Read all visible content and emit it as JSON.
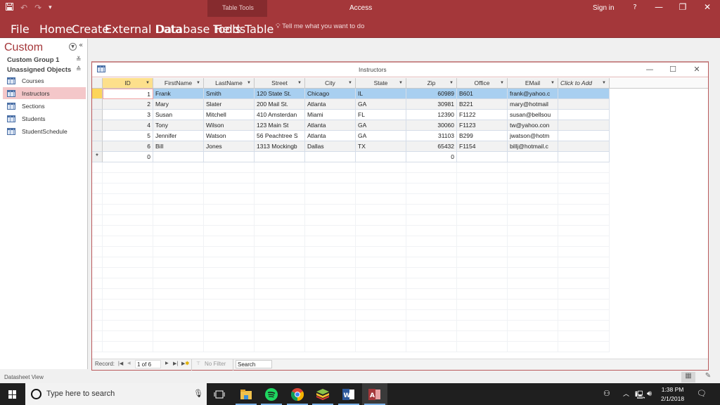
{
  "window": {
    "app_title": "Access",
    "contextual_title": "Table Tools",
    "sign_in": "Sign in",
    "help": "?",
    "minimize": "—",
    "restore": "❐",
    "close": "✕"
  },
  "qat": {
    "save": "💾",
    "undo": "↶",
    "redo": "↷",
    "customize": "⩡"
  },
  "ribbon": {
    "tabs": [
      {
        "label": "File"
      },
      {
        "label": "Home"
      },
      {
        "label": "Create"
      },
      {
        "label": "External Data"
      },
      {
        "label": "Database Tools"
      },
      {
        "label": "Fields"
      },
      {
        "label": "Table"
      }
    ],
    "tell_me": "Tell me what you want to do"
  },
  "nav": {
    "title": "Custom",
    "groups": [
      {
        "label": "Custom Group 1",
        "chevron": "⌄"
      },
      {
        "label": "Unassigned Objects",
        "chevron": "⌃"
      }
    ],
    "items": [
      {
        "label": "Courses"
      },
      {
        "label": "Instructors",
        "selected": true
      },
      {
        "label": "Sections"
      },
      {
        "label": "Students"
      },
      {
        "label": "StudentSchedule"
      }
    ]
  },
  "doc": {
    "title": "Instructors",
    "columns": [
      "ID",
      "FirstName",
      "LastName",
      "Street",
      "City",
      "State",
      "Zip",
      "Office",
      "EMail",
      "Click to Add"
    ],
    "rows": [
      [
        "1",
        "Frank",
        "Smith",
        "120 State St.",
        "Chicago",
        "IL",
        "60989",
        "B601",
        "frank@yahoo.c"
      ],
      [
        "2",
        "Mary",
        "Slater",
        "200 Mail St.",
        "Atlanta",
        "GA",
        "30981",
        "B221",
        "mary@hotmail"
      ],
      [
        "3",
        "Susan",
        "Mitchell",
        "410 Amsterdan",
        "Miami",
        "FL",
        "12390",
        "F1122",
        "susan@bellsou"
      ],
      [
        "4",
        "Tony",
        "Wilson",
        "123 Main St",
        "Atlanta",
        "GA",
        "30060",
        "F1123",
        "tw@yahoo.con"
      ],
      [
        "5",
        "Jennifer",
        "Watson",
        "56 Peachtree S",
        "Atlanta",
        "GA",
        "31103",
        "B299",
        "jwatson@hotm"
      ],
      [
        "6",
        "Bill",
        "Jones",
        "1313 Mockingb",
        "Dallas",
        "TX",
        "65432",
        "F1154",
        "billj@hotmail.c"
      ]
    ],
    "new_row": {
      "marker": "*",
      "id": "0",
      "zip": "0"
    }
  },
  "recnav": {
    "label": "Record:",
    "first": "⏮",
    "prev": "◀",
    "current": "1 of 6",
    "next": "▶",
    "last": "⏭",
    "new": "▶✱",
    "filter": "No Filter",
    "search": "Search"
  },
  "status": {
    "view": "Datasheet View"
  },
  "taskbar": {
    "search_placeholder": "Type here to search",
    "time": "1:38 PM",
    "date": "2/1/2018"
  }
}
